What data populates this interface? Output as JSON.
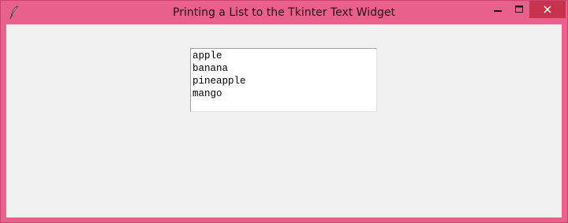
{
  "window": {
    "title": "Printing a List to the Tkinter Text Widget",
    "icon": "feather-icon",
    "controls": {
      "minimize_icon": "minimize-icon",
      "maximize_icon": "maximize-icon",
      "close_icon": "close-icon"
    },
    "colors": {
      "frame": "#e8608c",
      "close_button": "#c7334b",
      "client_background": "#f0f0f0"
    }
  },
  "text_widget": {
    "lines": [
      "apple",
      "banana",
      "pineapple",
      "mango"
    ]
  }
}
